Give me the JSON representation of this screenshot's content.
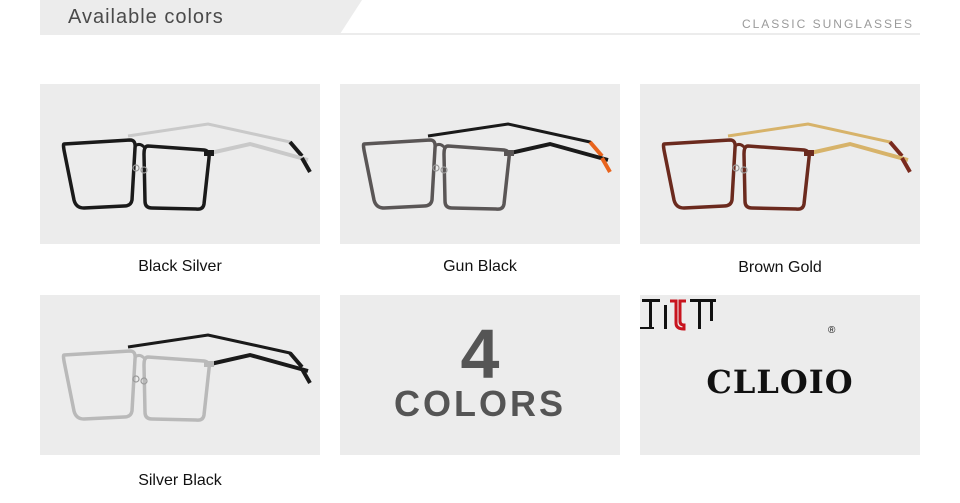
{
  "header": {
    "title": "Available colors",
    "subtitle": "CLASSIC SUNGLASSES"
  },
  "variants": [
    {
      "label": "Black Silver",
      "frame_color": "#1a1a1a",
      "temple_color": "#c9c9c9",
      "tip_color": "#1a1a1a"
    },
    {
      "label": "Gun Black",
      "frame_color": "#5a5656",
      "temple_color": "#1a1a1a",
      "tip_color": "#e8641e"
    },
    {
      "label": "Brown Gold",
      "frame_color": "#6b2a1e",
      "temple_color": "#d7b36a",
      "tip_color": "#7a2a1e"
    },
    {
      "label": "Silver Black",
      "frame_color": "#b9b9b9",
      "temple_color": "#1a1a1a",
      "tip_color": "#1a1a1a"
    }
  ],
  "count_tile": {
    "number": "4",
    "word": "COLORS"
  },
  "brand": {
    "name": "CLLOIO",
    "registered": "®",
    "accent_color": "#c8141e"
  }
}
